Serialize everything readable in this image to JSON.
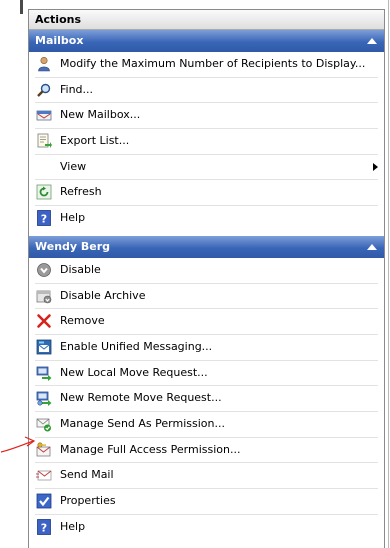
{
  "title": "Actions",
  "sections": [
    {
      "header": "Mailbox",
      "items": [
        {
          "label": "Modify the Maximum Number of Recipients to Display...",
          "icon": "user-settings-icon"
        },
        {
          "label": "Find...",
          "icon": "find-icon"
        },
        {
          "label": "New Mailbox...",
          "icon": "new-mailbox-icon"
        },
        {
          "label": "Export List...",
          "icon": "export-list-icon"
        },
        {
          "label": "View",
          "icon": "",
          "submenu": true
        },
        {
          "label": "Refresh",
          "icon": "refresh-icon"
        },
        {
          "label": "Help",
          "icon": "help-icon"
        }
      ]
    },
    {
      "header": "Wendy Berg",
      "items": [
        {
          "label": "Disable",
          "icon": "disable-icon"
        },
        {
          "label": "Disable Archive",
          "icon": "disable-archive-icon"
        },
        {
          "label": "Remove",
          "icon": "remove-icon"
        },
        {
          "label": "Enable Unified Messaging...",
          "icon": "unified-messaging-icon"
        },
        {
          "label": "New Local Move Request...",
          "icon": "local-move-icon"
        },
        {
          "label": "New Remote Move Request...",
          "icon": "remote-move-icon"
        },
        {
          "label": "Manage Send As Permission...",
          "icon": "send-as-permission-icon"
        },
        {
          "label": "Manage Full Access Permission...",
          "icon": "full-access-permission-icon"
        },
        {
          "label": "Send Mail",
          "icon": "send-mail-icon"
        },
        {
          "label": "Properties",
          "icon": "properties-icon"
        },
        {
          "label": "Help",
          "icon": "help-icon"
        }
      ]
    }
  ],
  "colors": {
    "section_header": "#3a66b8",
    "annotation": "#e0201c"
  }
}
